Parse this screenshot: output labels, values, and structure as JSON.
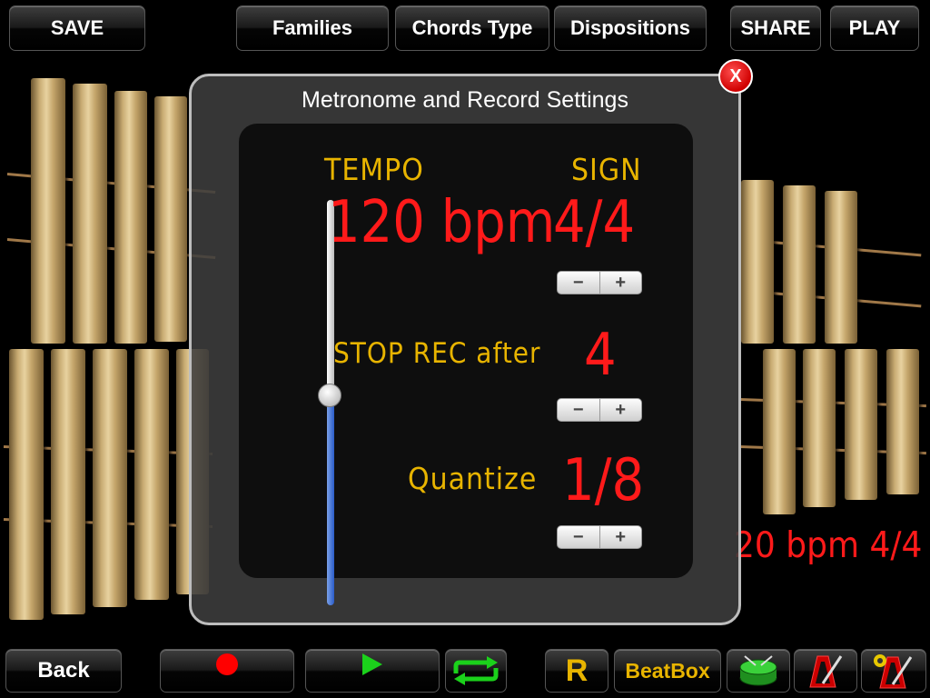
{
  "toolbar": {
    "save": "SAVE",
    "families": "Families",
    "chords_type": "Chords Type",
    "dispositions": "Dispositions",
    "share": "SHARE",
    "play": "PLAY"
  },
  "dialog": {
    "title": "Metronome and Record Settings",
    "close": "X",
    "tempo_label": "TEMPO",
    "tempo_value": "120 bpm",
    "sign_label": "SIGN",
    "sign_value": "4/4",
    "stop_rec_label": "STOP REC after",
    "stop_rec_value": "4",
    "quantize_label": "Quantize",
    "quantize_value": "1/8",
    "stepper_minus": "−",
    "stepper_plus": "+",
    "tempo_slider_level": 0.52
  },
  "background_readout": "20 bpm 4/4",
  "bottom_bar": {
    "back": "Back",
    "r": "R",
    "beatbox": "BeatBox"
  },
  "colors": {
    "accent_yellow": "#e8b400",
    "digital_red": "#ff1a1a",
    "loop_green": "#1bd11b",
    "record_red": "#ff0000"
  },
  "icons": [
    "record-icon",
    "play-icon",
    "loop-icon",
    "drum-icon",
    "metronome-icon",
    "metronome-settings-icon"
  ]
}
